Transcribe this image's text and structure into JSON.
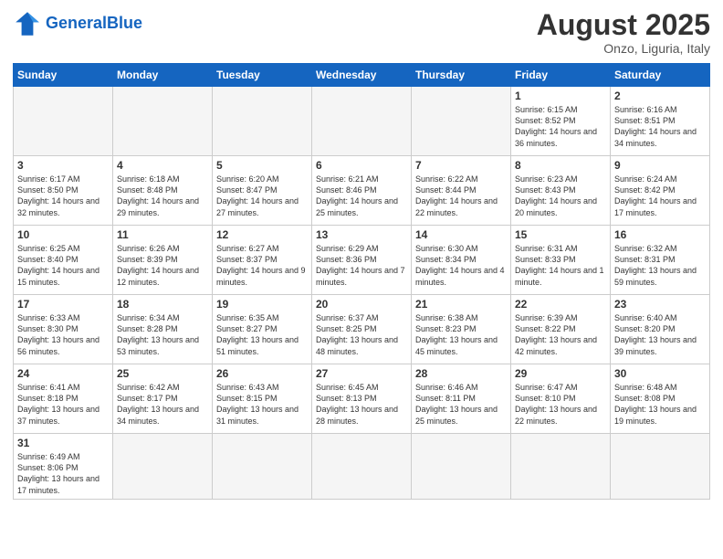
{
  "header": {
    "logo_general": "General",
    "logo_blue": "Blue",
    "month_title": "August 2025",
    "subtitle": "Onzo, Liguria, Italy"
  },
  "weekdays": [
    "Sunday",
    "Monday",
    "Tuesday",
    "Wednesday",
    "Thursday",
    "Friday",
    "Saturday"
  ],
  "weeks": [
    [
      {
        "day": "",
        "info": "",
        "empty": true
      },
      {
        "day": "",
        "info": "",
        "empty": true
      },
      {
        "day": "",
        "info": "",
        "empty": true
      },
      {
        "day": "",
        "info": "",
        "empty": true
      },
      {
        "day": "",
        "info": "",
        "empty": true
      },
      {
        "day": "1",
        "info": "Sunrise: 6:15 AM\nSunset: 8:52 PM\nDaylight: 14 hours and 36 minutes."
      },
      {
        "day": "2",
        "info": "Sunrise: 6:16 AM\nSunset: 8:51 PM\nDaylight: 14 hours and 34 minutes."
      }
    ],
    [
      {
        "day": "3",
        "info": "Sunrise: 6:17 AM\nSunset: 8:50 PM\nDaylight: 14 hours and 32 minutes."
      },
      {
        "day": "4",
        "info": "Sunrise: 6:18 AM\nSunset: 8:48 PM\nDaylight: 14 hours and 29 minutes."
      },
      {
        "day": "5",
        "info": "Sunrise: 6:20 AM\nSunset: 8:47 PM\nDaylight: 14 hours and 27 minutes."
      },
      {
        "day": "6",
        "info": "Sunrise: 6:21 AM\nSunset: 8:46 PM\nDaylight: 14 hours and 25 minutes."
      },
      {
        "day": "7",
        "info": "Sunrise: 6:22 AM\nSunset: 8:44 PM\nDaylight: 14 hours and 22 minutes."
      },
      {
        "day": "8",
        "info": "Sunrise: 6:23 AM\nSunset: 8:43 PM\nDaylight: 14 hours and 20 minutes."
      },
      {
        "day": "9",
        "info": "Sunrise: 6:24 AM\nSunset: 8:42 PM\nDaylight: 14 hours and 17 minutes."
      }
    ],
    [
      {
        "day": "10",
        "info": "Sunrise: 6:25 AM\nSunset: 8:40 PM\nDaylight: 14 hours and 15 minutes."
      },
      {
        "day": "11",
        "info": "Sunrise: 6:26 AM\nSunset: 8:39 PM\nDaylight: 14 hours and 12 minutes."
      },
      {
        "day": "12",
        "info": "Sunrise: 6:27 AM\nSunset: 8:37 PM\nDaylight: 14 hours and 9 minutes."
      },
      {
        "day": "13",
        "info": "Sunrise: 6:29 AM\nSunset: 8:36 PM\nDaylight: 14 hours and 7 minutes."
      },
      {
        "day": "14",
        "info": "Sunrise: 6:30 AM\nSunset: 8:34 PM\nDaylight: 14 hours and 4 minutes."
      },
      {
        "day": "15",
        "info": "Sunrise: 6:31 AM\nSunset: 8:33 PM\nDaylight: 14 hours and 1 minute."
      },
      {
        "day": "16",
        "info": "Sunrise: 6:32 AM\nSunset: 8:31 PM\nDaylight: 13 hours and 59 minutes."
      }
    ],
    [
      {
        "day": "17",
        "info": "Sunrise: 6:33 AM\nSunset: 8:30 PM\nDaylight: 13 hours and 56 minutes."
      },
      {
        "day": "18",
        "info": "Sunrise: 6:34 AM\nSunset: 8:28 PM\nDaylight: 13 hours and 53 minutes."
      },
      {
        "day": "19",
        "info": "Sunrise: 6:35 AM\nSunset: 8:27 PM\nDaylight: 13 hours and 51 minutes."
      },
      {
        "day": "20",
        "info": "Sunrise: 6:37 AM\nSunset: 8:25 PM\nDaylight: 13 hours and 48 minutes."
      },
      {
        "day": "21",
        "info": "Sunrise: 6:38 AM\nSunset: 8:23 PM\nDaylight: 13 hours and 45 minutes."
      },
      {
        "day": "22",
        "info": "Sunrise: 6:39 AM\nSunset: 8:22 PM\nDaylight: 13 hours and 42 minutes."
      },
      {
        "day": "23",
        "info": "Sunrise: 6:40 AM\nSunset: 8:20 PM\nDaylight: 13 hours and 39 minutes."
      }
    ],
    [
      {
        "day": "24",
        "info": "Sunrise: 6:41 AM\nSunset: 8:18 PM\nDaylight: 13 hours and 37 minutes."
      },
      {
        "day": "25",
        "info": "Sunrise: 6:42 AM\nSunset: 8:17 PM\nDaylight: 13 hours and 34 minutes."
      },
      {
        "day": "26",
        "info": "Sunrise: 6:43 AM\nSunset: 8:15 PM\nDaylight: 13 hours and 31 minutes."
      },
      {
        "day": "27",
        "info": "Sunrise: 6:45 AM\nSunset: 8:13 PM\nDaylight: 13 hours and 28 minutes."
      },
      {
        "day": "28",
        "info": "Sunrise: 6:46 AM\nSunset: 8:11 PM\nDaylight: 13 hours and 25 minutes."
      },
      {
        "day": "29",
        "info": "Sunrise: 6:47 AM\nSunset: 8:10 PM\nDaylight: 13 hours and 22 minutes."
      },
      {
        "day": "30",
        "info": "Sunrise: 6:48 AM\nSunset: 8:08 PM\nDaylight: 13 hours and 19 minutes."
      }
    ],
    [
      {
        "day": "31",
        "info": "Sunrise: 6:49 AM\nSunset: 8:06 PM\nDaylight: 13 hours and 17 minutes."
      },
      {
        "day": "",
        "info": "",
        "empty": true
      },
      {
        "day": "",
        "info": "",
        "empty": true
      },
      {
        "day": "",
        "info": "",
        "empty": true
      },
      {
        "day": "",
        "info": "",
        "empty": true
      },
      {
        "day": "",
        "info": "",
        "empty": true
      },
      {
        "day": "",
        "info": "",
        "empty": true
      }
    ]
  ]
}
